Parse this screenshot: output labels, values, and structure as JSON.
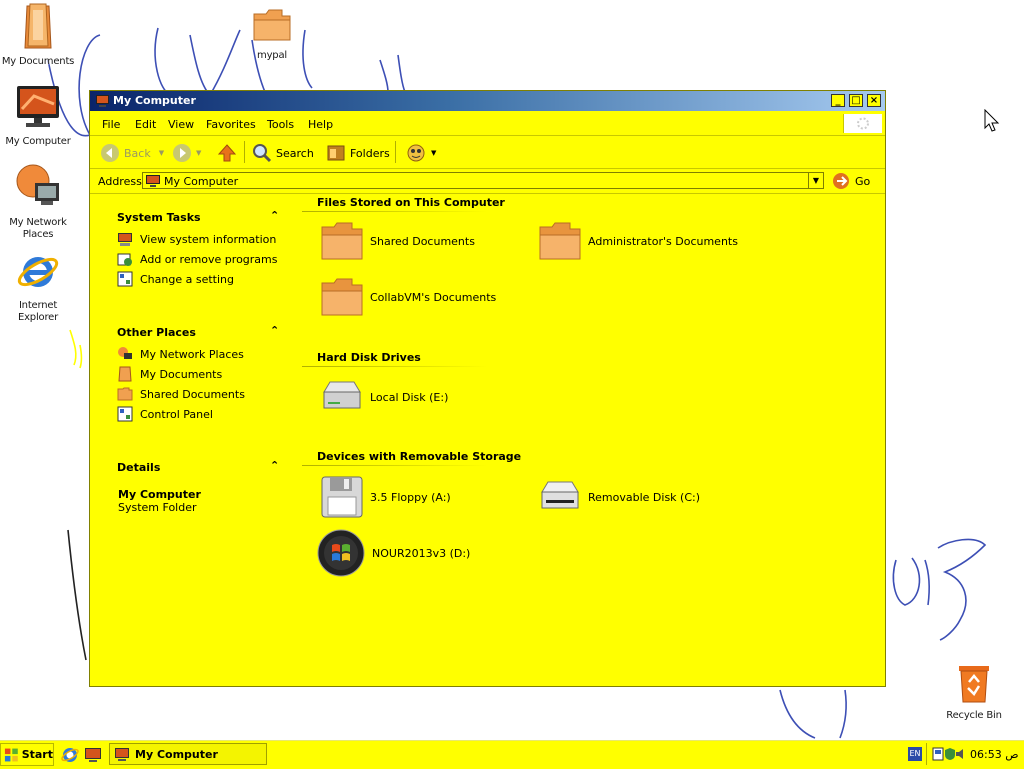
{
  "desktop": {
    "icons": [
      {
        "label": "My Documents"
      },
      {
        "label": "mypal"
      },
      {
        "label": "My Computer"
      },
      {
        "label": "My Network Places"
      },
      {
        "label": "Internet Explorer"
      },
      {
        "label": "Recycle Bin"
      }
    ]
  },
  "window": {
    "title": "My Computer",
    "controls": {
      "minimize": "_",
      "maximize": "□",
      "close": "×"
    },
    "menu": [
      "File",
      "Edit",
      "View",
      "Favorites",
      "Tools",
      "Help"
    ],
    "toolbar": {
      "back": "Back",
      "search": "Search",
      "folders": "Folders"
    },
    "address": {
      "label": "Address",
      "value": "My Computer",
      "go": "Go"
    },
    "left_pane": {
      "system_tasks": {
        "title": "System Tasks",
        "items": [
          "View system information",
          "Add or remove programs",
          "Change a setting"
        ]
      },
      "other_places": {
        "title": "Other Places",
        "items": [
          "My Network Places",
          "My Documents",
          "Shared Documents",
          "Control Panel"
        ]
      },
      "details": {
        "title": "Details",
        "name": "My Computer",
        "type": "System Folder"
      }
    },
    "content": {
      "groups": [
        {
          "title": "Files Stored on This Computer",
          "items": [
            "Shared Documents",
            "Administrator's Documents",
            "CollabVM's Documents"
          ]
        },
        {
          "title": "Hard Disk Drives",
          "items": [
            "Local Disk (E:)"
          ]
        },
        {
          "title": "Devices with Removable Storage",
          "items": [
            "3.5 Floppy (A:)",
            "Removable Disk (C:)",
            "NOUR2013v3 (D:)"
          ]
        }
      ]
    }
  },
  "taskbar": {
    "start_label": "Start",
    "active_task": "My Computer",
    "language": "EN",
    "clock_time": "06:53",
    "clock_suffix": "ص"
  },
  "colors": {
    "window_background": "#ffff00",
    "titlebar_start": "#0a246a",
    "folder_orange": "#f3a14b"
  }
}
